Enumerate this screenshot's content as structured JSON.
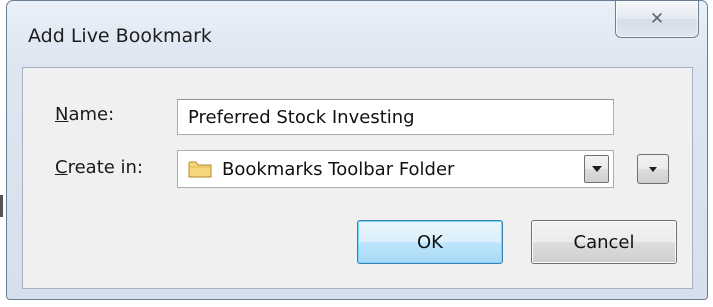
{
  "window": {
    "title": "Add Live Bookmark",
    "close_icon": "close-icon"
  },
  "form": {
    "name_label_mnemonic": "N",
    "name_label_rest": "ame:",
    "name_value": "Preferred Stock Investing",
    "create_label_mnemonic": "C",
    "create_label_rest": "reate in:",
    "create_in_value": "Bookmarks Toolbar Folder",
    "folder_icon": "folder-icon"
  },
  "buttons": {
    "ok_label": "OK",
    "cancel_label": "Cancel"
  },
  "colors": {
    "accent": "#3c7fb1",
    "folder_fill": "#f6d77a"
  }
}
